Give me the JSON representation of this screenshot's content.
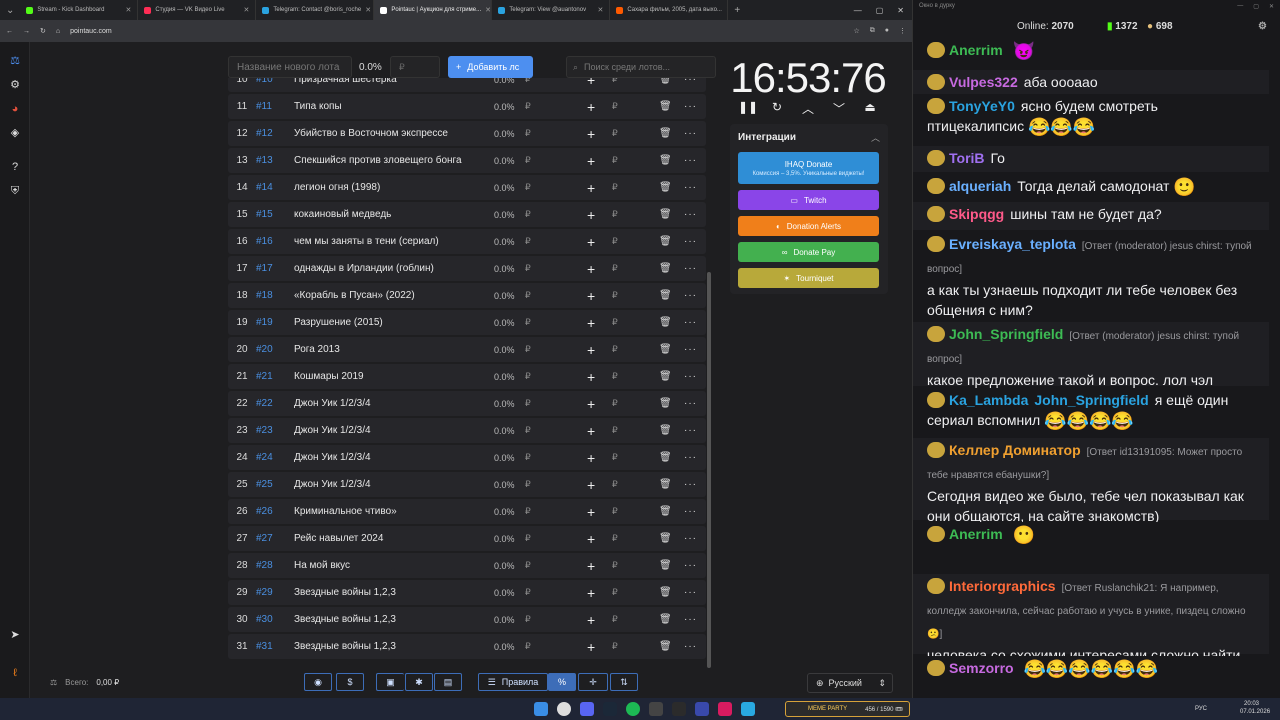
{
  "browser": {
    "tabs": [
      {
        "title": "Stream - Kick Dashboard",
        "color": "#53fc18"
      },
      {
        "title": "Студия — VK Видео Live",
        "color": "#ff2d55"
      },
      {
        "title": "Telegram: Contact @boris_roche",
        "color": "#2aa3e0"
      },
      {
        "title": "Pointauc | Аукцион для стриме...",
        "color": "#ffffff"
      },
      {
        "title": "Telegram: View @auantonov",
        "color": "#2aa3e0"
      },
      {
        "title": "Сахара фильм, 2005, дата выхо...",
        "color": "#ff5a00"
      }
    ],
    "url": "pointauc.com"
  },
  "lot_form": {
    "name_placeholder": "Название нового лота",
    "percent": "0.0%",
    "amount_placeholder": "₽",
    "add_button": "Добавить лс",
    "search_placeholder": "Поиск среди лотов..."
  },
  "lots": [
    {
      "num": "10",
      "id": "#10",
      "name": "Призрачная шестерка"
    },
    {
      "num": "11",
      "id": "#11",
      "name": "Типа копы"
    },
    {
      "num": "12",
      "id": "#12",
      "name": "Убийство в Восточном экспрессе"
    },
    {
      "num": "13",
      "id": "#13",
      "name": "Спекшийся против зловещего бонга"
    },
    {
      "num": "14",
      "id": "#14",
      "name": "легион огня (1998)"
    },
    {
      "num": "15",
      "id": "#15",
      "name": "кокаиновый медведь"
    },
    {
      "num": "16",
      "id": "#16",
      "name": "чем мы заняты в тени (сериал)"
    },
    {
      "num": "17",
      "id": "#17",
      "name": "однажды в Ирландии (гоблин)"
    },
    {
      "num": "18",
      "id": "#18",
      "name": "«Корабль в Пусан» (2022)"
    },
    {
      "num": "19",
      "id": "#19",
      "name": "Разрушение (2015)"
    },
    {
      "num": "20",
      "id": "#20",
      "name": "Рога 2013"
    },
    {
      "num": "21",
      "id": "#21",
      "name": "Кошмары 2019"
    },
    {
      "num": "22",
      "id": "#22",
      "name": "Джон Уик 1/2/3/4"
    },
    {
      "num": "23",
      "id": "#23",
      "name": "Джон Уик 1/2/3/4"
    },
    {
      "num": "24",
      "id": "#24",
      "name": "Джон Уик 1/2/3/4"
    },
    {
      "num": "25",
      "id": "#25",
      "name": "Джон Уик 1/2/3/4"
    },
    {
      "num": "26",
      "id": "#26",
      "name": "Криминальное чтиво»"
    },
    {
      "num": "27",
      "id": "#27",
      "name": "Рейс навылет 2024"
    },
    {
      "num": "28",
      "id": "#28",
      "name": "На мой вкус"
    },
    {
      "num": "29",
      "id": "#29",
      "name": "Звездные войны 1,2,3"
    },
    {
      "num": "30",
      "id": "#30",
      "name": "Звездные войны 1,2,3"
    },
    {
      "num": "31",
      "id": "#31",
      "name": "Звездные войны 1,2,3"
    }
  ],
  "lot_common": {
    "percent": "0.0%",
    "currency": "₽"
  },
  "timer": {
    "value": "16:53:76"
  },
  "integrations": {
    "title": "Интеграции",
    "ihaq": {
      "label": "IHAQ Donate",
      "sub": "Комиссия – 3,5%. Уникальные виджеты!",
      "color": "#2f8ed6"
    },
    "buttons": [
      {
        "label": "Twitch",
        "color": "#8a45e8"
      },
      {
        "label": "Donation Alerts",
        "color": "#f07f1a"
      },
      {
        "label": "Donate Pay",
        "color": "#43b04f"
      },
      {
        "label": "Tourniquet",
        "color": "#b8a93a"
      }
    ]
  },
  "footer": {
    "total_label": "Всего:",
    "total_value": "0,00 ₽",
    "rules_label": "Правила",
    "language": "Русский"
  },
  "chat": {
    "window_title": "Окно в дурку",
    "online_label": "Online:",
    "online_value": "2070",
    "kick_count": "1372",
    "other_count": "698",
    "messages": [
      {
        "name": "Anerrim",
        "color": "#3dbb54",
        "text": "",
        "emote": "😈"
      },
      {
        "name": "Vulpes322",
        "color": "#c76ae0",
        "text": "аба ооoаао",
        "emote": ""
      },
      {
        "name": "TonyYeY0",
        "color": "#2aa3e0",
        "text": "ясно будем смотреть птицекалипсис",
        "emote": "😂😂😂"
      },
      {
        "name": "ToriB",
        "color": "#a070f0",
        "text": "Го",
        "emote": ""
      },
      {
        "name": "alqueriah",
        "color": "#6ab0ff",
        "text": "Тогда делай самодонат",
        "emote": "🙂"
      },
      {
        "name": "Skipqgg",
        "color": "#ff5a8a",
        "text": "шины там не будет да?",
        "emote": ""
      },
      {
        "name": "Evreiskaya_teplota",
        "color": "#6ab0ff",
        "reply": "[Ответ (moderator) jesus chirst: тупой вопрос]",
        "text": "а как ты узнаешь подходит ли тебе человек без общения с ним?",
        "emote": ""
      },
      {
        "name": "John_Springfield",
        "color": "#3dbb54",
        "reply": "[Ответ (moderator) jesus chirst: тупой вопрос]",
        "text": "какое предложение такой и вопрос. лол чэл",
        "emote": ""
      },
      {
        "name": "Ka_Lambda",
        "color": "#2aa3e0",
        "mention": "John_Springfield",
        "text": "я ещё один сериал вспомнил",
        "emote": "😂😂😂😂"
      },
      {
        "name": "Келлер Доминатор",
        "color": "#f0a030",
        "reply": "[Ответ id13191095: Может просто тебе нравятся ебанушки?]",
        "text": "Сегодня видео же было, тебе чел показывал как они общаются, на сайте знакомств)",
        "emote": ""
      },
      {
        "name": "Anerrim",
        "color": "#3dbb54",
        "text": "",
        "emote": "😶"
      },
      {
        "name": "Interiorgraphics",
        "color": "#ff6a3a",
        "reply": "[Ответ Ruslanchik21: Я например, колледж закончила, сейчас работаю и учусь в унике, пиздец сложно 😕]",
        "text": "человека со схожими интересами сложно найти после уника или общими темами",
        "emote": ""
      },
      {
        "name": "Semzorro",
        "color": "#c76ae0",
        "text": "",
        "emote": "😂😂😂😂😂😂"
      }
    ]
  },
  "taskbar": {
    "meme_label": "MEME PARTY",
    "meme_progress": "456 / 1590 🎟",
    "lang": "РУС",
    "time": "20:03",
    "date": "07.01.2026"
  }
}
